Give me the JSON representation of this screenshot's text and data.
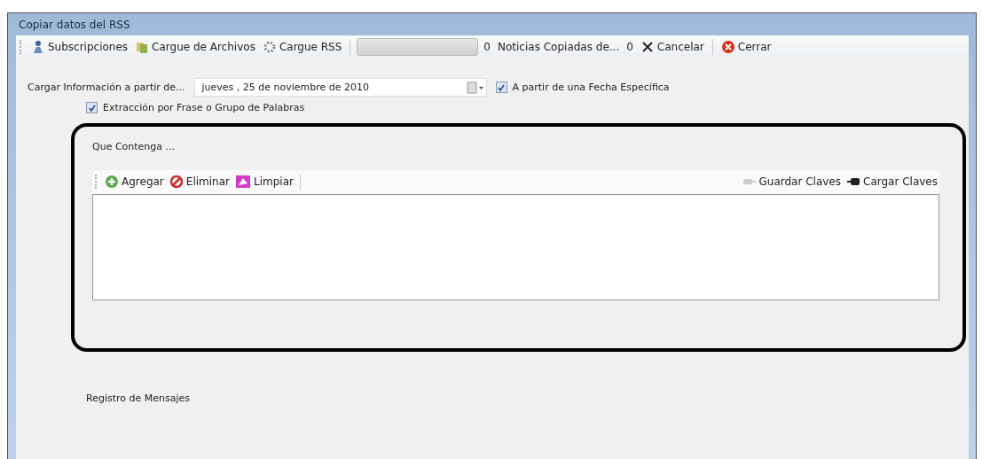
{
  "window": {
    "title": "Copiar datos del RSS"
  },
  "toolbar": {
    "items": [
      {
        "kind": "button",
        "label": "Subscripciones"
      },
      {
        "kind": "button",
        "label": "Cargue de Archivos"
      },
      {
        "kind": "button",
        "label": "Cargue RSS"
      },
      {
        "kind": "separator"
      },
      {
        "kind": "progress",
        "level": 0
      },
      {
        "kind": "text",
        "label": "0"
      },
      {
        "kind": "text",
        "label": "Noticias Copiadas de..."
      },
      {
        "kind": "text",
        "label": "0"
      },
      {
        "kind": "button",
        "label": "Cancelar"
      },
      {
        "kind": "separator"
      },
      {
        "kind": "button",
        "label": "Cerrar"
      }
    ]
  },
  "date_row": {
    "label": "Cargar Información a partir de...",
    "date": "jueves   , 25 de noviembre de 2010",
    "specific_date": {
      "label": "A partir de una Fecha Específica",
      "checked": true
    }
  },
  "phrase_extraction": {
    "label": "Extracción por Frase o Grupo de Palabras",
    "checked": true
  },
  "contains_panel": {
    "title": "Que Contenga ...",
    "toolbar_left": [
      {
        "label": "Agregar"
      },
      {
        "label": "Eliminar"
      },
      {
        "label": "Limpiar"
      }
    ],
    "toolbar_right": [
      {
        "label": "Guardar Claves"
      },
      {
        "label": "Cargar Claves"
      }
    ]
  },
  "message_log": {
    "title": "Registro de Mensajes"
  }
}
